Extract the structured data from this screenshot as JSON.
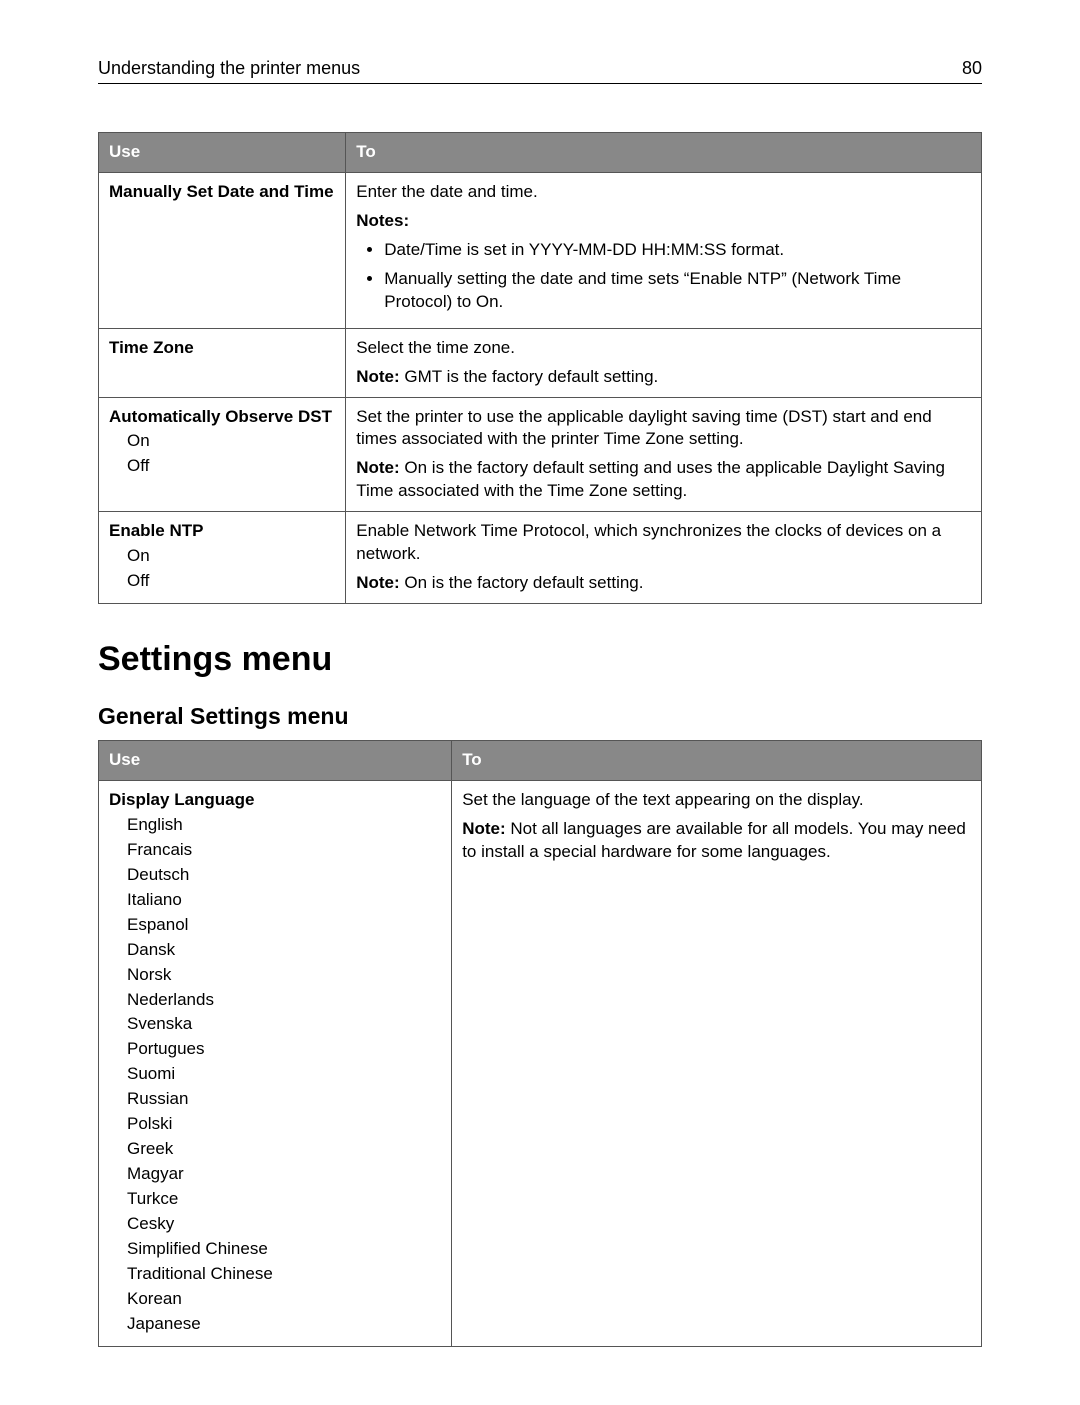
{
  "header": {
    "title": "Understanding the printer menus",
    "page_number": "80"
  },
  "table1": {
    "headers": {
      "col1": "Use",
      "col2": "To"
    },
    "rows": [
      {
        "left": {
          "title": "Manually Set Date and Time",
          "options": []
        },
        "right": {
          "lead": "Enter the date and time.",
          "notes_label": "Notes:",
          "notes": [
            "Date/Time is set in YYYY-MM-DD HH:MM:SS format.",
            "Manually setting the date and time sets “Enable NTP” (Network Time Protocol) to On."
          ]
        }
      },
      {
        "left": {
          "title": "Time Zone",
          "options": []
        },
        "right": {
          "lead": "Select the time zone.",
          "note_label": "Note:",
          "note_text": " GMT is the factory default setting."
        }
      },
      {
        "left": {
          "title": "Automatically Observe DST",
          "options": [
            "On",
            "Off"
          ]
        },
        "right": {
          "lead": "Set the printer to use the applicable daylight saving time (DST) start and end times associated with the printer Time Zone setting.",
          "note_label": "Note:",
          "note_text": " On is the factory default setting and uses the applicable Daylight Saving Time associated with the Time Zone setting."
        }
      },
      {
        "left": {
          "title": "Enable NTP",
          "options": [
            "On",
            "Off"
          ]
        },
        "right": {
          "lead": "Enable Network Time Protocol, which synchronizes the clocks of devices on a network.",
          "note_label": "Note:",
          "note_text": " On is the factory default setting."
        }
      }
    ]
  },
  "section_title": "Settings menu",
  "subsection_title": "General Settings menu",
  "table2": {
    "headers": {
      "col1": "Use",
      "col2": "To"
    },
    "row": {
      "left": {
        "title": "Display Language",
        "options": [
          "English",
          "Francais",
          "Deutsch",
          "Italiano",
          "Espanol",
          "Dansk",
          "Norsk",
          "Nederlands",
          "Svenska",
          "Portugues",
          "Suomi",
          "Russian",
          "Polski",
          "Greek",
          "Magyar",
          "Turkce",
          "Cesky",
          "Simplified Chinese",
          "Traditional Chinese",
          "Korean",
          "Japanese"
        ]
      },
      "right": {
        "lead": "Set the language of the text appearing on the display.",
        "note_label": "Note:",
        "note_text": " Not all languages are available for all models. You may need to install a special hardware for some languages."
      }
    }
  }
}
